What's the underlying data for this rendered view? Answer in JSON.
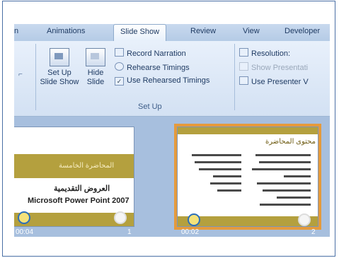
{
  "tabs": [
    {
      "label": "n",
      "active": false
    },
    {
      "label": "Animations",
      "active": false
    },
    {
      "label": "Slide Show",
      "active": true
    },
    {
      "label": "Review",
      "active": false
    },
    {
      "label": "View",
      "active": false
    },
    {
      "label": "Developer",
      "active": false
    }
  ],
  "setup_group": {
    "set_up_slide_show": "Set Up\nSlide Show",
    "hide_slide": "Hide\nSlide",
    "record_narration": "Record Narration",
    "rehearse_timings": "Rehearse Timings",
    "use_rehearsed_timings": "Use Rehearsed Timings",
    "group_label": "Set Up"
  },
  "monitors_group": {
    "resolution": "Resolution:",
    "show_presentation": "Show Presentati",
    "use_presenter_view": "Use Presenter V"
  },
  "slides": [
    {
      "title": "المحاضرة الخامسة",
      "subtitle_ar": "العروض التقديمية",
      "subtitle_en": "Microsoft Power Point 2007",
      "time": "00:04",
      "number": "1"
    },
    {
      "title": "محتوى المحاضرة",
      "time": "00:02",
      "number": "2"
    }
  ],
  "colors": {
    "band": "#b4a03e",
    "selection": "#e59a3c",
    "ribbon": "#dbe7f6"
  }
}
